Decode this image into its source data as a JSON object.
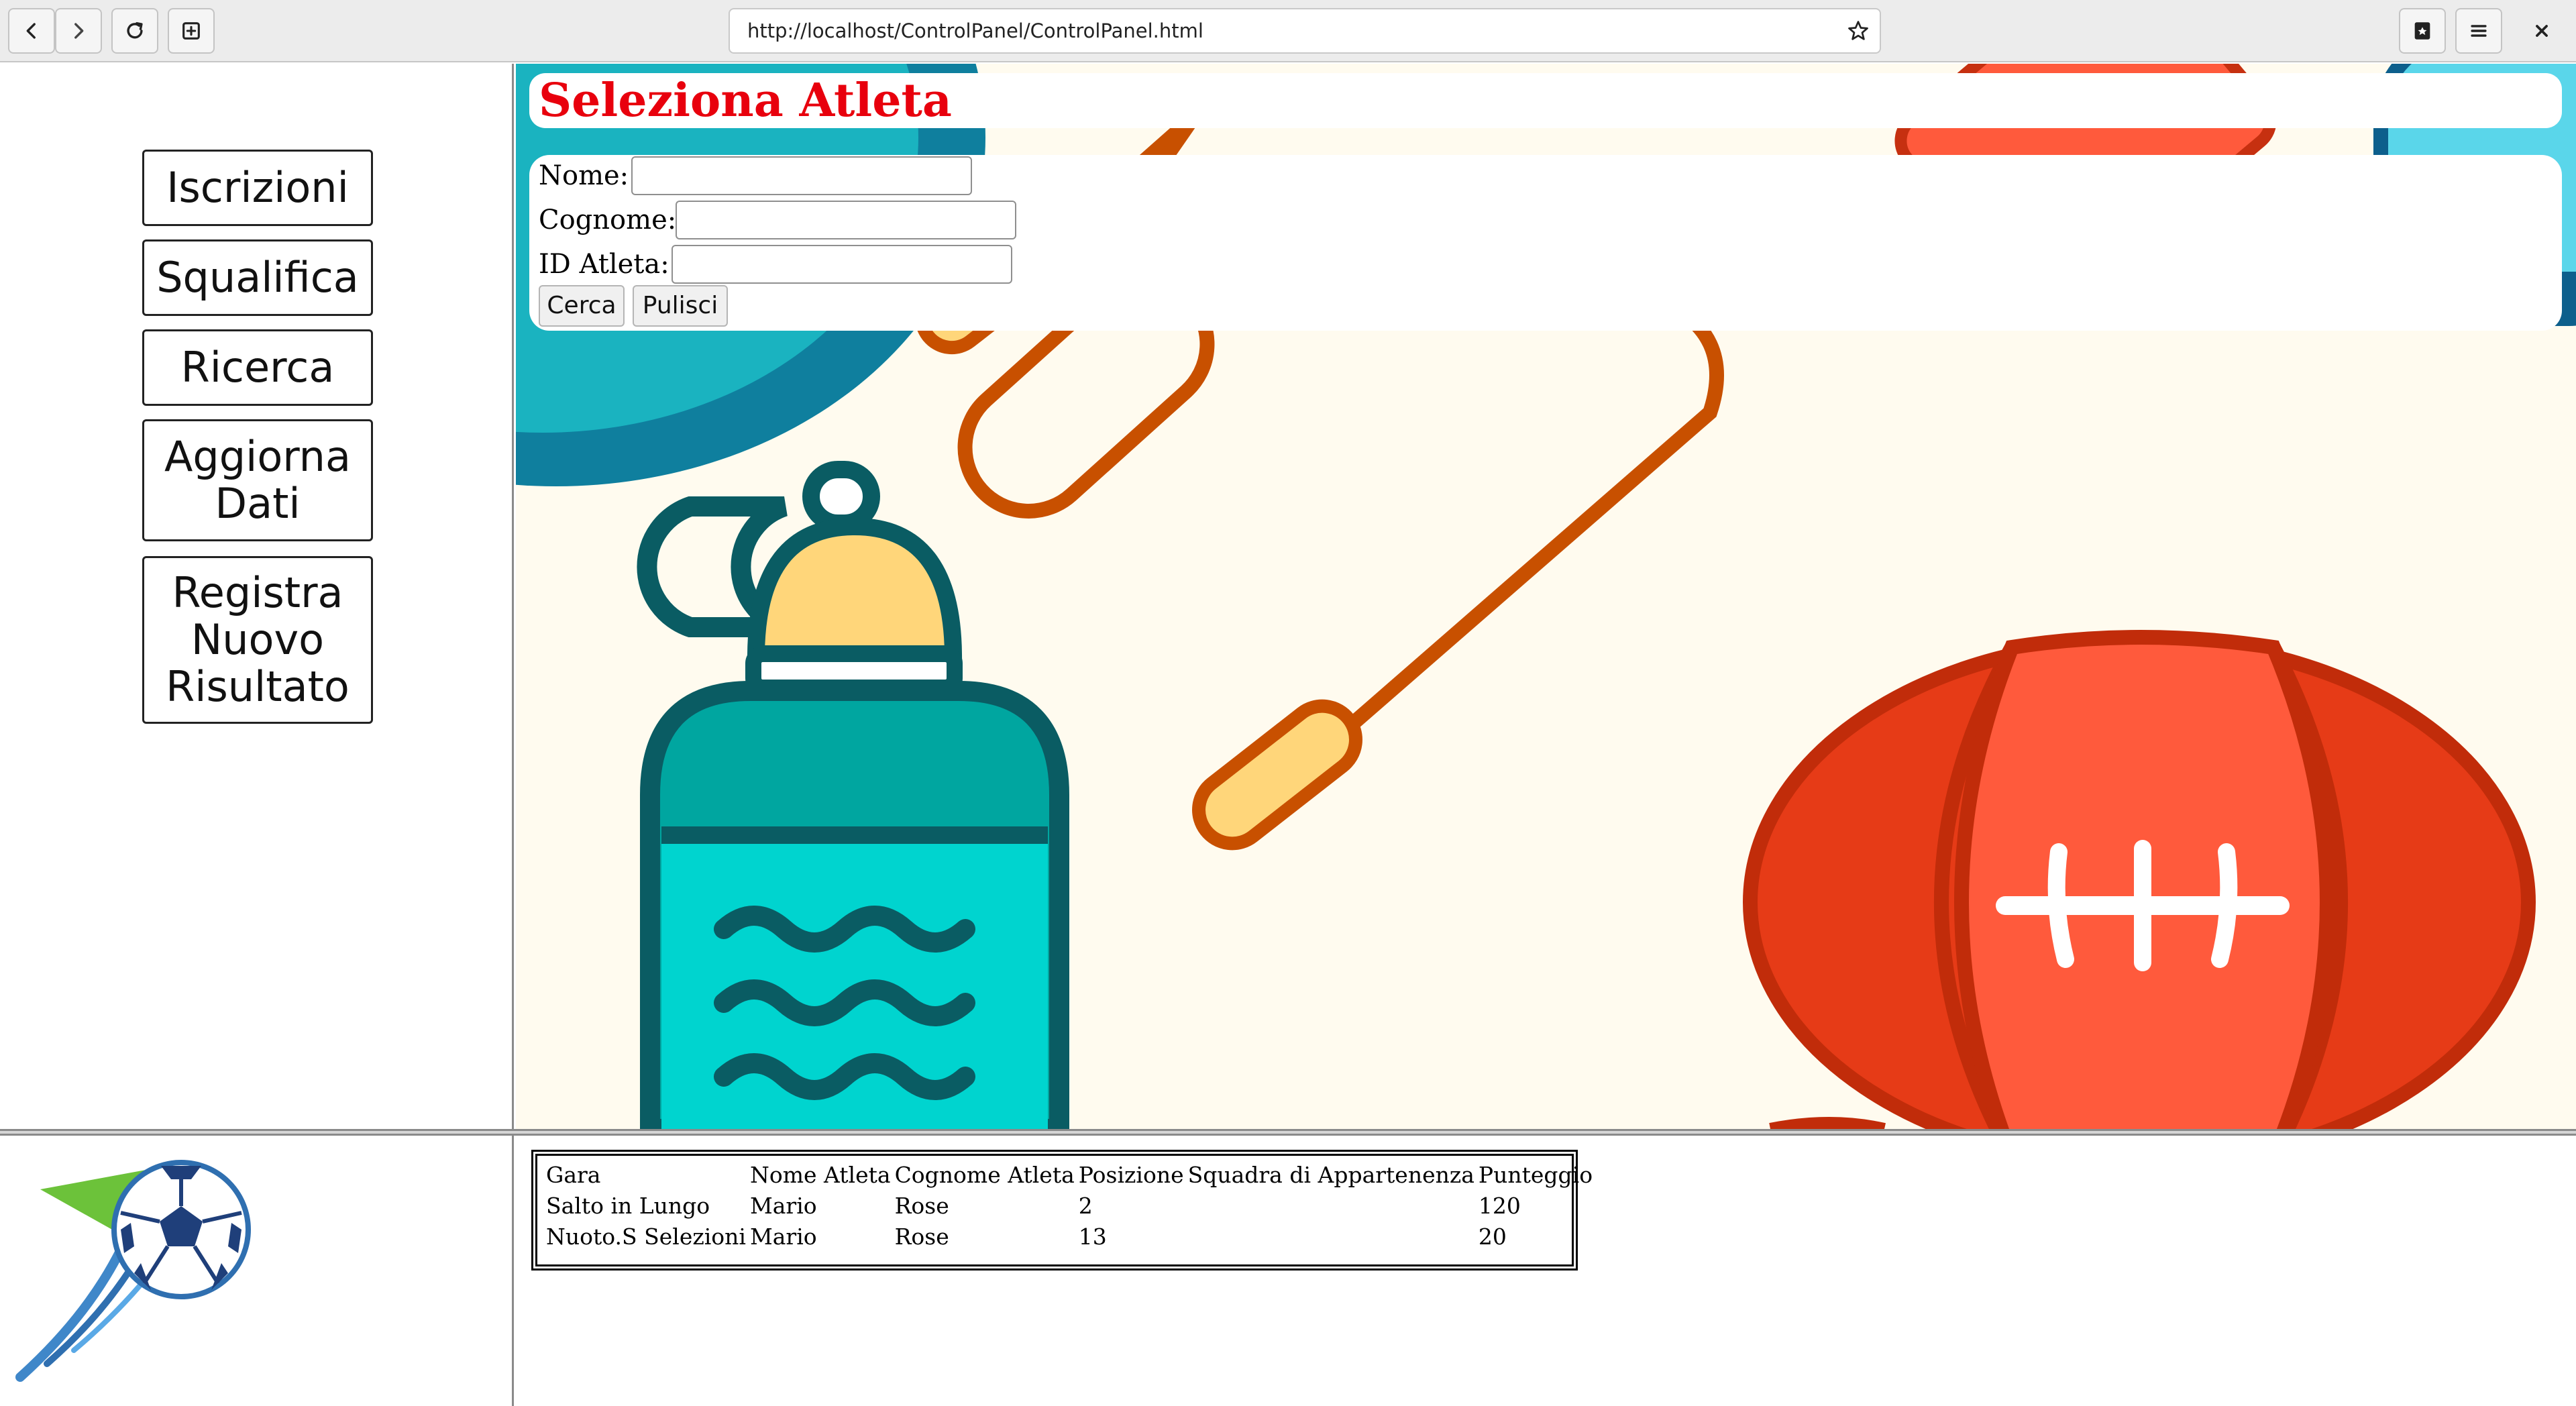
{
  "browser": {
    "url": "http://localhost/ControlPanel/ControlPanel.html"
  },
  "sidebar": {
    "buttons": [
      {
        "label": "Iscrizioni"
      },
      {
        "label": "Squalifica"
      },
      {
        "label": "Ricerca"
      },
      {
        "label": "Aggiorna Dati"
      },
      {
        "label": "Registra Nuovo Risultato"
      }
    ]
  },
  "search": {
    "title": "Seleziona Atleta",
    "fields": {
      "name_label": "Nome:",
      "surname_label": "Cognome:",
      "id_label": "ID Atleta:"
    },
    "search_button": "Cerca",
    "clear_button": "Pulisci"
  },
  "results": {
    "headers": [
      "Gara",
      "Nome Atleta",
      "Cognome Atleta",
      "Posizione",
      "Squadra di Appartenenza",
      "Punteggio"
    ],
    "rows": [
      [
        "Salto in Lungo",
        "Mario",
        "Rose",
        "2",
        "",
        "120"
      ],
      [
        "Nuoto.S Selezioni",
        "Mario",
        "Rose",
        "13",
        "",
        "20"
      ]
    ]
  },
  "colors": {
    "title": "#e8000d",
    "background": "#fffbef",
    "ball": "#ff5a3c",
    "bottle": "#00d4cf",
    "rope": "#c85000"
  },
  "icons": [
    "back-icon",
    "forward-icon",
    "reload-icon",
    "new-tab-icon",
    "bookmark-star-icon",
    "reader-icon",
    "menu-icon",
    "close-icon",
    "soccer-logo"
  ]
}
